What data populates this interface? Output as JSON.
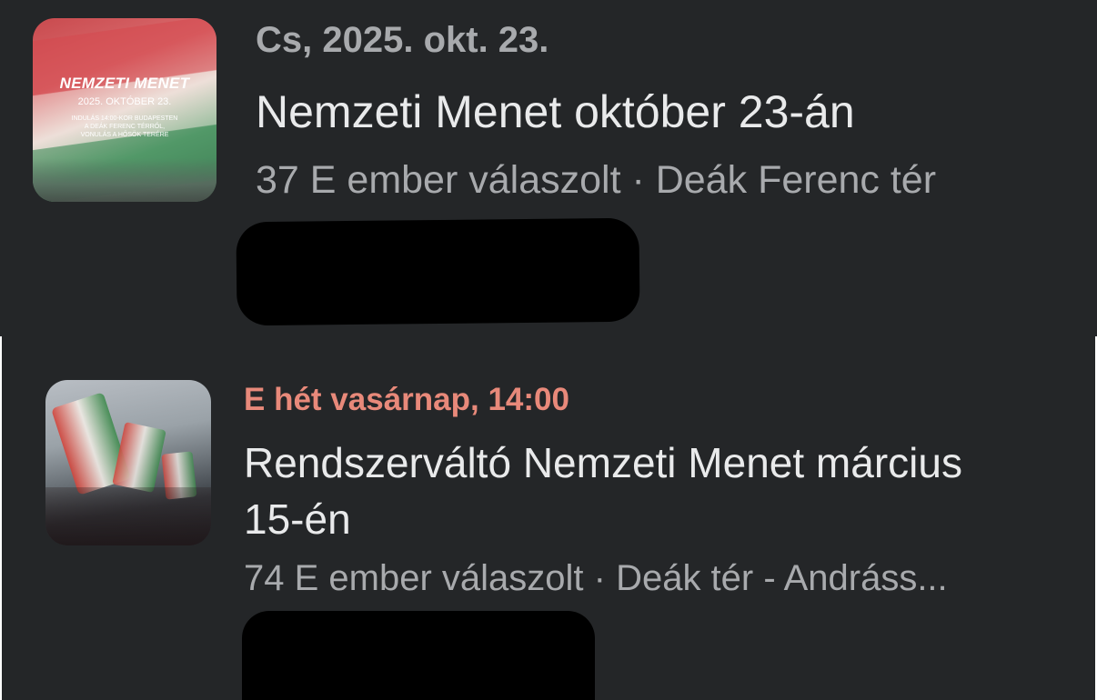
{
  "events": [
    {
      "date": "Cs, 2025. okt. 23.",
      "title": "Nemzeti Menet október 23-án",
      "meta": "37 E ember válaszolt · Deák Ferenc tér",
      "date_color": "#a8aaad",
      "thumbnail": {
        "title": "NEMZETI MENET",
        "date": "2025. OKTÓBER 23.",
        "lines": [
          "INDULÁS 14:00-KOR BUDAPESTEN",
          "A DEÁK FERENC TÉRRŐL,",
          "VONULÁS A HŐSÖK TERÉRE"
        ]
      }
    },
    {
      "date": "E hét vasárnap, 14:00",
      "title_line1": "Rendszerváltó Nemzeti Menet március",
      "title_line2": "15-én",
      "meta": "74 E ember válaszolt · Deák tér - Andráss...",
      "date_color": "#e8897a"
    }
  ],
  "colors": {
    "background": "#242628",
    "title_text": "#e9eaeb",
    "secondary_text": "#a8aaad",
    "highlight_date": "#e8897a",
    "redaction": "#000000"
  }
}
